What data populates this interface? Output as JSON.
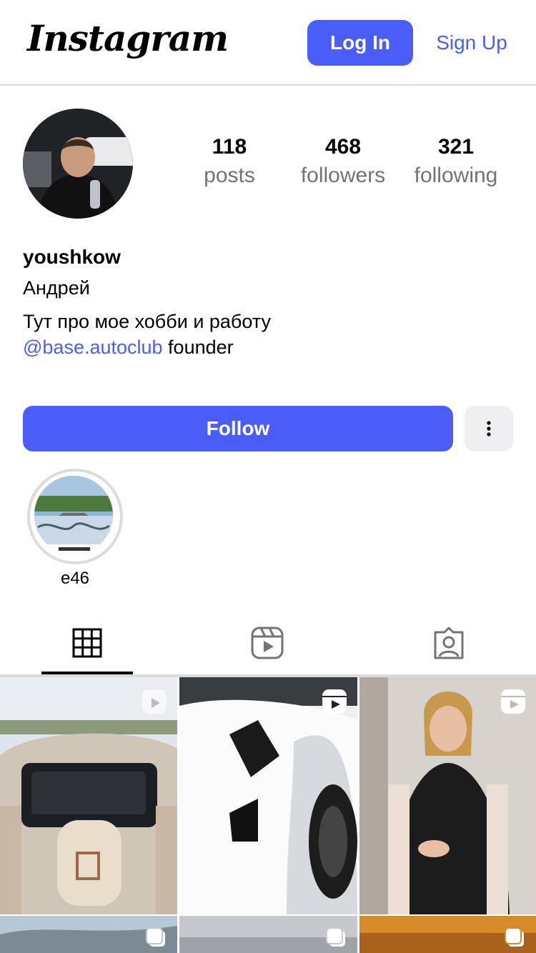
{
  "header": {
    "logo": "Instagram",
    "login_label": "Log In",
    "signup_label": "Sign Up"
  },
  "profile": {
    "posts_count": "118",
    "posts_label": "posts",
    "followers_count": "468",
    "followers_label": "followers",
    "following_count": "321",
    "following_label": "following",
    "username": "youshkow",
    "full_name": "Андрей",
    "bio_line1": "Тут про мое хобби и работу",
    "bio_mention": "@base.autoclub",
    "bio_suffix": " founder"
  },
  "actions": {
    "follow_label": "Follow"
  },
  "highlights": [
    {
      "label": "e46"
    }
  ],
  "tabs": [
    {
      "name": "posts",
      "icon": "grid-icon",
      "active": true
    },
    {
      "name": "reels",
      "icon": "reels-icon",
      "active": false
    },
    {
      "name": "tagged",
      "icon": "tagged-icon",
      "active": false
    }
  ],
  "grid": [
    {
      "type": "reel",
      "icon": "reels-badge-icon"
    },
    {
      "type": "reel",
      "icon": "reels-badge-icon"
    },
    {
      "type": "reel",
      "icon": "reels-badge-icon"
    },
    {
      "type": "carousel",
      "icon": "carousel-badge-icon"
    },
    {
      "type": "carousel",
      "icon": "carousel-badge-icon"
    },
    {
      "type": "carousel",
      "icon": "carousel-badge-icon"
    }
  ],
  "colors": {
    "accent": "#4a5df9",
    "muted_text": "#737373",
    "border": "#dbdbdb"
  }
}
